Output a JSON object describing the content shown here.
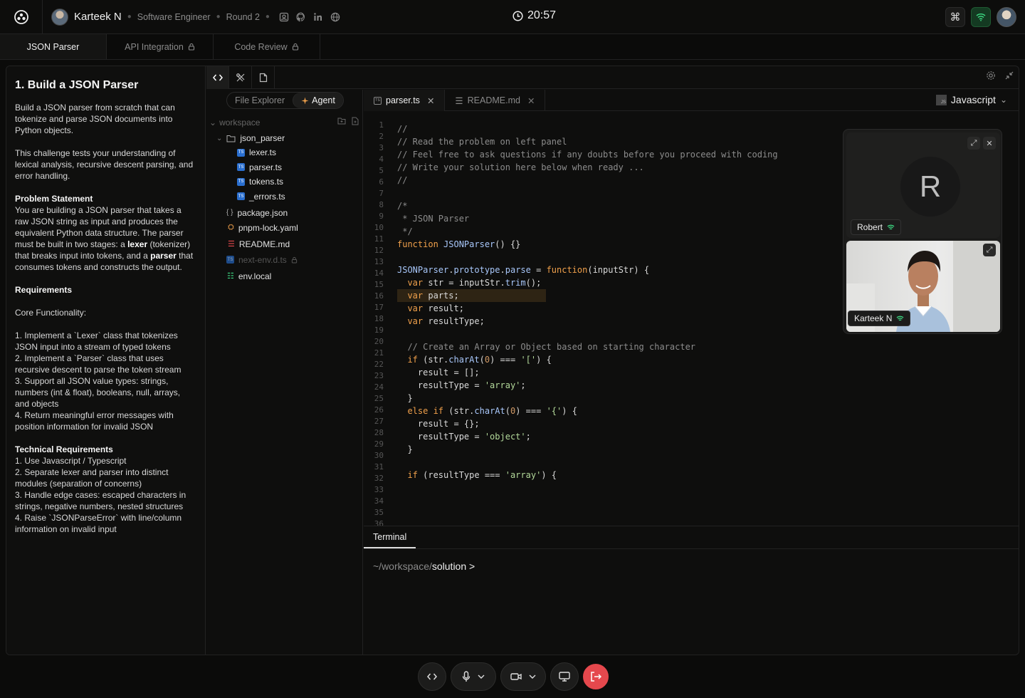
{
  "header": {
    "user_name": "Karteek N",
    "role": "Software Engineer",
    "round": "Round 2",
    "timer": "20:57"
  },
  "question_tabs": [
    {
      "label": "JSON Parser",
      "locked": false
    },
    {
      "label": "API Integration",
      "locked": true
    },
    {
      "label": "Code Review",
      "locked": true
    }
  ],
  "problem": {
    "title": "1. Build a JSON Parser",
    "intro1": "Build a JSON parser from scratch that can tokenize and parse JSON documents into Python objects.",
    "intro2": "This challenge tests your understanding of lexical analysis, recursive descent parsing, and error handling.",
    "statement_heading": "Problem Statement",
    "statement_part1": "You are building a JSON parser that takes a raw JSON string as input and produces the equivalent Python data structure. The parser must be built in two stages: a ",
    "statement_bold1": "lexer",
    "statement_part2": " (tokenizer) that breaks input into tokens, and a ",
    "statement_bold2": "parser",
    "statement_part3": " that consumes tokens and constructs the output.",
    "requirements_heading": "Requirements",
    "core_heading": "Core Functionality:",
    "core_items": [
      "1. Implement a `Lexer` class that tokenizes JSON input into a stream of typed tokens",
      "2. Implement a `Parser` class that uses recursive descent to parse the token stream",
      "3. Support all JSON value types: strings, numbers (int & float), booleans, null, arrays, and objects",
      "4. Return meaningful error messages with position information for invalid JSON"
    ],
    "tech_heading": "Technical Requirements",
    "tech_items": [
      "1. Use Javascript / Typescript",
      "2. Separate lexer and parser into distinct modules (separation of concerns)",
      "3. Handle edge cases: escaped characters in strings, negative numbers, nested structures",
      "4. Raise `JSONParseError` with line/column information on invalid input"
    ]
  },
  "explorer": {
    "seg_file": "File Explorer",
    "seg_agent": "Agent",
    "workspace": "workspace",
    "folder": "json_parser",
    "folder_files": [
      "lexer.ts",
      "parser.ts",
      "tokens.ts",
      "_errors.ts"
    ],
    "root_files": [
      "package.json",
      "pnpm-lock.yaml",
      "README.md",
      "next-env.d.ts",
      "env.local"
    ]
  },
  "editor": {
    "tabs": [
      "parser.ts",
      "README.md"
    ],
    "language": "Javascript",
    "js_badge": "JS",
    "line_count": 36
  },
  "video": {
    "remote_initial": "R",
    "remote_name": "Robert",
    "local_name": "Karteek N"
  },
  "terminal": {
    "tab": "Terminal",
    "path_prefix": "~/workspace/",
    "path_dir": "solution",
    "prompt_char": " >"
  },
  "colors": {
    "accent_green": "#3ddc84",
    "leave_red": "#e5484d",
    "keyword": "#f0a04b"
  }
}
